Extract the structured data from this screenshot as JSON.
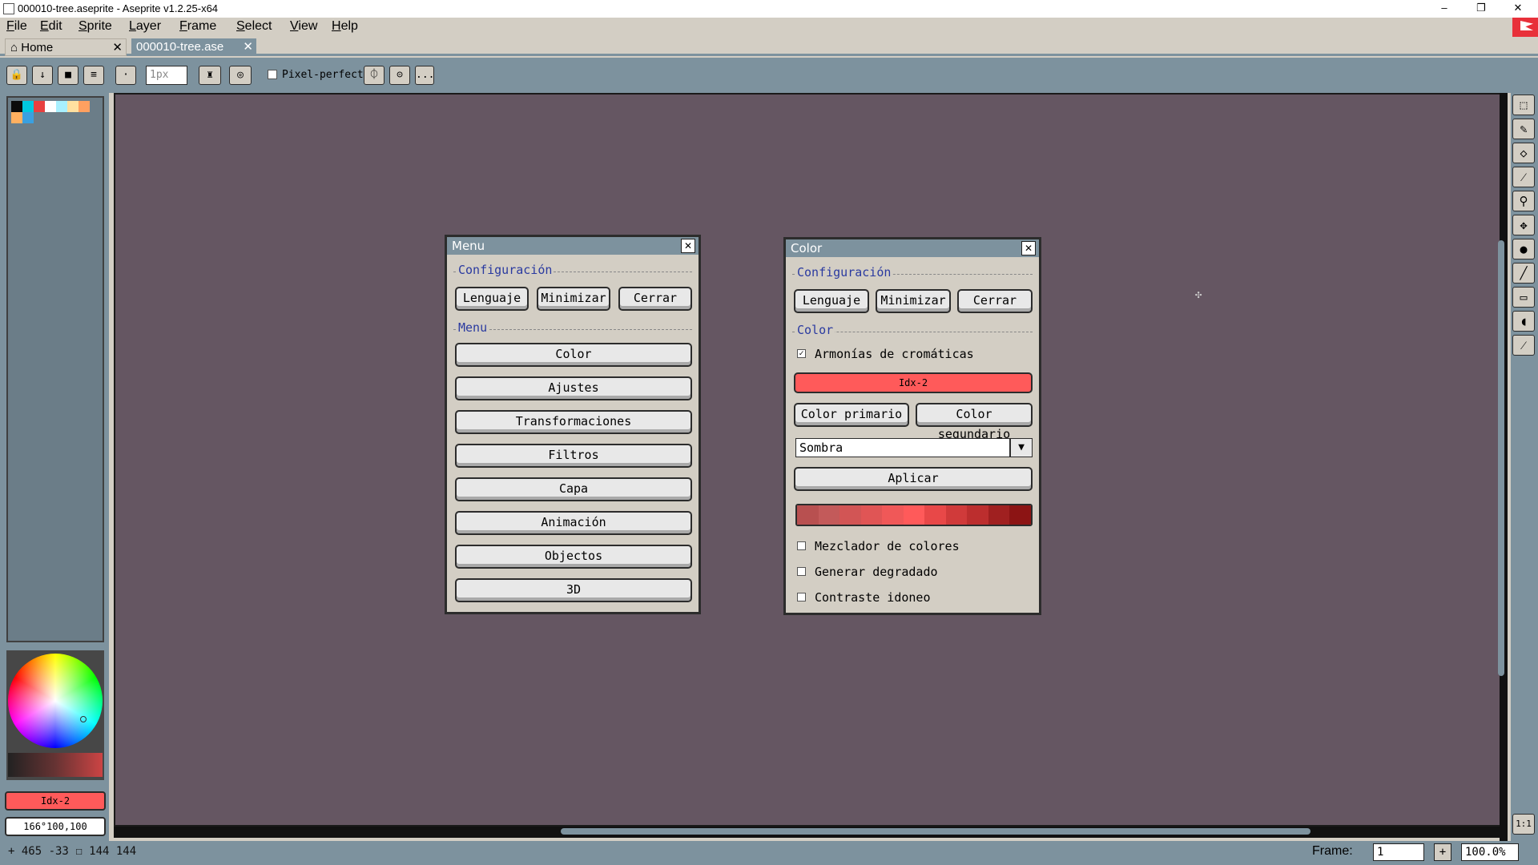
{
  "window": {
    "title": "000010-tree.aseprite - Aseprite v1.2.25-x64",
    "minimize": "–",
    "restore": "❐",
    "close": "✕"
  },
  "menubar": [
    "File",
    "Edit",
    "Sprite",
    "Layer",
    "Frame",
    "Select",
    "View",
    "Help"
  ],
  "tabs": {
    "home": "Home",
    "home_icon": "home-icon",
    "file": "000010-tree.ase",
    "close_glyph": "✕"
  },
  "context_bar": {
    "brush_size": "1px",
    "pixel_perfect": "Pixel-perfect",
    "more": "..."
  },
  "palette": {
    "swatches": [
      "#0b0b0b",
      "#00c8e0",
      "#e84040",
      "#ffffff",
      "#a8f0ff",
      "#ffe0a0",
      "#ffa060",
      "#ffb060",
      "#3aa0e0"
    ]
  },
  "color_bar": {
    "fg_label": "Idx-2",
    "fg_color": "#ff5a5a",
    "value_label": "166°100,100"
  },
  "status": {
    "position": "+ 465 -33  ☐ 144 144",
    "frame_label": "Frame:",
    "frame_value": "1",
    "frame_add": "+",
    "zoom": "100.0%"
  },
  "menu_dialog": {
    "title": "Menu",
    "config_section": "Configuración",
    "lenguaje": "Lenguaje",
    "minimizar": "Minimizar",
    "cerrar": "Cerrar",
    "menu_section": "Menu",
    "items": [
      "Color",
      "Ajustes",
      "Transformaciones",
      "Filtros",
      "Capa",
      "Animación",
      "Objectos",
      "3D"
    ]
  },
  "color_dialog": {
    "title": "Color",
    "config_section": "Configuración",
    "lenguaje": "Lenguaje",
    "minimizar": "Minimizar",
    "cerrar": "Cerrar",
    "color_section": "Color",
    "harmonies": "Armonías de cromáticas",
    "harmonies_checked": true,
    "idx_label": "Idx-2",
    "color_primario": "Color primario",
    "color_segundario": "Color segundario",
    "mode_select": "Sombra",
    "aplicar": "Aplicar",
    "shade_colors": [
      "#b85050",
      "#c35a5a",
      "#d25555",
      "#e05555",
      "#f05858",
      "#ff5a5a",
      "#e84848",
      "#d03a3a",
      "#bc2e2e",
      "#a02020",
      "#8c1414"
    ],
    "options": [
      "Mezclador de colores",
      "Generar degradado",
      "Contraste idoneo"
    ]
  }
}
